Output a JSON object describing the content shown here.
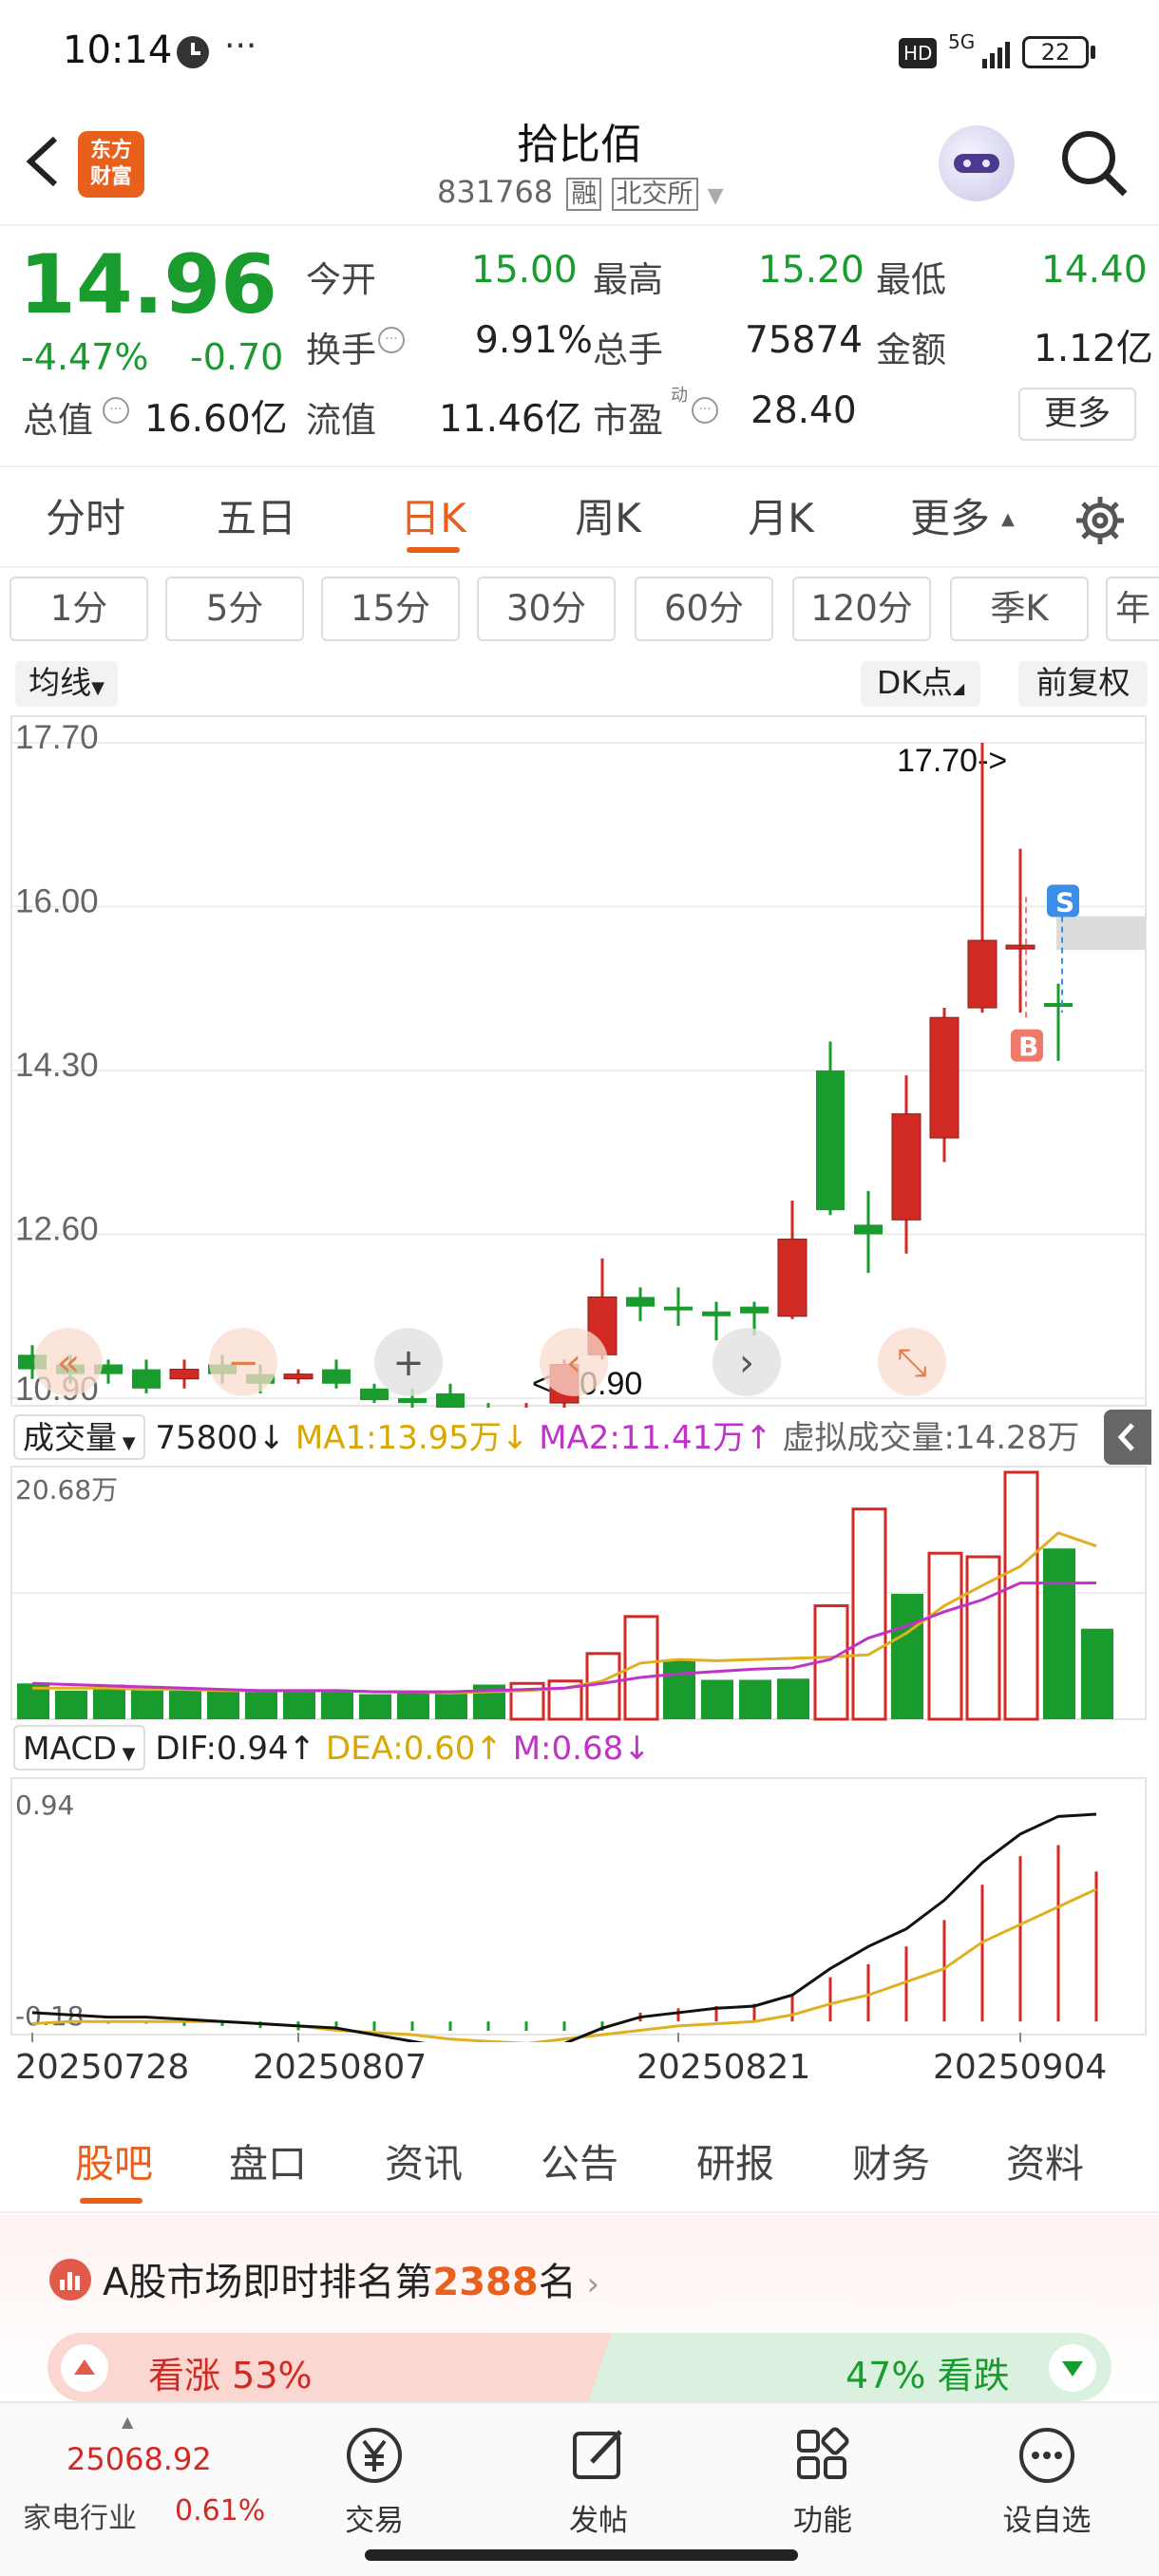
{
  "status_bar": {
    "time": "10:14",
    "dots": "···",
    "hd": "HD",
    "network": "5G",
    "battery": "22"
  },
  "header": {
    "logo_line1": "东方",
    "logo_line2": "财富",
    "stock_name": "拾比佰",
    "stock_code": "831768",
    "tag_margin": "融",
    "tag_exchange": "北交所"
  },
  "quote": {
    "price": "14.96",
    "change_pct": "-4.47%",
    "change_amt": "-0.70",
    "fields": {
      "open_label": "今开",
      "open": "15.00",
      "high_label": "最高",
      "high": "15.20",
      "low_label": "最低",
      "low": "14.40",
      "turnover_label": "换手",
      "turnover": "9.91%",
      "volume_label": "总手",
      "volume": "75874",
      "amount_label": "金额",
      "amount": "1.12亿",
      "total_value_label": "总值",
      "total_value": "16.60亿",
      "float_value_label": "流值",
      "float_value": "11.46亿",
      "pe_label": "市盈",
      "pe_sup": "动",
      "pe": "28.40"
    },
    "more_button": "更多"
  },
  "period_tabs": [
    "分时",
    "五日",
    "日K",
    "周K",
    "月K",
    "更多"
  ],
  "active_period": "日K",
  "minute_pills": [
    "1分",
    "5分",
    "15分",
    "30分",
    "60分",
    "120分",
    "季K",
    "年"
  ],
  "chart_controls": {
    "ma_label": "均线",
    "dk_label": "DK点",
    "adjust_label": "前复权"
  },
  "chart_data": [
    {
      "type": "candlestick",
      "title": "日K",
      "y_ticks": [
        "17.70",
        "16.00",
        "14.30",
        "12.60",
        "10.90"
      ],
      "ylim": [
        10.9,
        17.7
      ],
      "max_annotation": "17.70->",
      "min_annotation": "<-10.90",
      "candles": [
        {
          "o": 11.35,
          "c": 11.2,
          "h": 11.45,
          "l": 11.1
        },
        {
          "o": 11.25,
          "c": 11.15,
          "h": 11.35,
          "l": 11.05
        },
        {
          "o": 11.25,
          "c": 11.15,
          "h": 11.3,
          "l": 11.05
        },
        {
          "o": 11.2,
          "c": 11.0,
          "h": 11.3,
          "l": 10.95
        },
        {
          "o": 11.1,
          "c": 11.2,
          "h": 11.3,
          "l": 11.0
        },
        {
          "o": 11.25,
          "c": 11.15,
          "h": 11.35,
          "l": 11.05
        },
        {
          "o": 11.15,
          "c": 11.05,
          "h": 11.25,
          "l": 10.95
        },
        {
          "o": 11.1,
          "c": 11.15,
          "h": 11.2,
          "l": 11.05
        },
        {
          "o": 11.2,
          "c": 11.05,
          "h": 11.3,
          "l": 11.0
        },
        {
          "o": 11.0,
          "c": 10.88,
          "h": 11.05,
          "l": 10.85
        },
        {
          "o": 10.9,
          "c": 10.85,
          "h": 11.0,
          "l": 10.8
        },
        {
          "o": 10.95,
          "c": 10.75,
          "h": 11.05,
          "l": 10.7
        },
        {
          "o": 10.8,
          "c": 10.65,
          "h": 10.85,
          "l": 10.6
        },
        {
          "o": 10.45,
          "c": 10.75,
          "h": 10.85,
          "l": 10.3
        },
        {
          "o": 10.85,
          "c": 11.25,
          "h": 11.3,
          "l": 10.8
        },
        {
          "o": 11.35,
          "c": 11.95,
          "h": 12.35,
          "l": 11.3
        },
        {
          "o": 11.95,
          "c": 11.85,
          "h": 12.05,
          "l": 11.7
        },
        {
          "o": 11.85,
          "c": 11.83,
          "h": 12.05,
          "l": 11.65
        },
        {
          "o": 11.8,
          "c": 11.75,
          "h": 11.9,
          "l": 11.5
        },
        {
          "o": 11.85,
          "c": 11.78,
          "h": 11.9,
          "l": 11.55
        },
        {
          "o": 11.75,
          "c": 12.55,
          "h": 12.95,
          "l": 11.72
        },
        {
          "o": 14.3,
          "c": 12.85,
          "h": 14.6,
          "l": 12.8
        },
        {
          "o": 12.7,
          "c": 12.6,
          "h": 13.05,
          "l": 12.2
        },
        {
          "o": 12.75,
          "c": 13.85,
          "h": 14.25,
          "l": 12.4
        },
        {
          "o": 13.6,
          "c": 14.85,
          "h": 14.95,
          "l": 13.35
        },
        {
          "o": 14.95,
          "c": 15.65,
          "h": 17.7,
          "l": 14.9
        },
        {
          "o": 15.6,
          "c": 15.6,
          "h": 16.6,
          "l": 14.9
        },
        {
          "o": 15.0,
          "c": 14.96,
          "h": 15.2,
          "l": 14.4
        }
      ],
      "markers": [
        {
          "label": "S",
          "color": "#3a8ee6"
        },
        {
          "label": "B",
          "color": "#f07a6a"
        }
      ]
    },
    {
      "type": "bar",
      "title": "成交量",
      "header_value": "75800",
      "series": [
        {
          "name": "MA1",
          "label": "MA1:13.95万",
          "color": "#e0b020"
        },
        {
          "name": "MA2",
          "label": "MA2:11.41万",
          "color": "#c032c8"
        }
      ],
      "virtual_volume_label": "虚拟成交量:14.28万",
      "y_max_label": "20.68万",
      "values": [
        3.0,
        2.4,
        2.9,
        2.6,
        2.5,
        2.4,
        2.3,
        2.5,
        2.4,
        2.1,
        2.2,
        2.4,
        2.9,
        3.0,
        3.2,
        5.5,
        8.6,
        4.9,
        3.3,
        3.3,
        3.4,
        9.5,
        17.6,
        10.5,
        13.9,
        13.6,
        20.68,
        14.3,
        7.58
      ],
      "rising": [
        false,
        false,
        false,
        false,
        false,
        false,
        false,
        false,
        false,
        false,
        false,
        false,
        false,
        true,
        true,
        true,
        true,
        false,
        false,
        false,
        false,
        true,
        true,
        false,
        true,
        true,
        true,
        false,
        false
      ],
      "ma1": [
        2.6,
        2.6,
        2.6,
        2.5,
        2.5,
        2.4,
        2.4,
        2.4,
        2.4,
        2.3,
        2.3,
        2.2,
        2.3,
        2.4,
        2.6,
        3.2,
        4.7,
        5.0,
        4.9,
        5.0,
        5.1,
        5.2,
        5.4,
        7.2,
        9.5,
        11.2,
        12.8,
        15.6,
        14.5
      ],
      "ma2": [
        3.0,
        2.9,
        2.8,
        2.7,
        2.6,
        2.5,
        2.4,
        2.4,
        2.4,
        2.3,
        2.3,
        2.3,
        2.4,
        2.5,
        2.6,
        3.0,
        3.5,
        3.8,
        4.0,
        4.2,
        4.3,
        5.0,
        6.8,
        7.8,
        9.0,
        10.0,
        11.4,
        11.4,
        11.41
      ]
    },
    {
      "type": "bar",
      "title": "MACD",
      "dif_label": "DIF:0.94",
      "dea_label": "DEA:0.60",
      "m_label": "M:0.68",
      "ylim": [
        -0.18,
        0.94
      ],
      "y_top_label": "0.94",
      "y_bottom_label": "-0.18",
      "x_labels": [
        "20250728",
        "20250807",
        "20250821",
        "20250904"
      ],
      "dif": [
        0.04,
        0.03,
        0.02,
        0.02,
        0.01,
        0.0,
        -0.01,
        -0.02,
        -0.03,
        -0.06,
        -0.09,
        -0.12,
        -0.15,
        -0.15,
        -0.1,
        -0.03,
        0.02,
        0.04,
        0.06,
        0.07,
        0.12,
        0.24,
        0.34,
        0.42,
        0.55,
        0.72,
        0.85,
        0.93,
        0.94
      ],
      "dea": [
        -0.01,
        -0.0,
        0.0,
        0.0,
        0.0,
        0.0,
        -0.01,
        -0.02,
        -0.04,
        -0.05,
        -0.06,
        -0.08,
        -0.09,
        -0.1,
        -0.08,
        -0.06,
        -0.04,
        -0.02,
        -0.01,
        0.0,
        0.03,
        0.08,
        0.12,
        0.18,
        0.24,
        0.36,
        0.44,
        0.52,
        0.6
      ],
      "m": [
        0.0,
        -0.01,
        -0.01,
        -0.01,
        -0.02,
        -0.02,
        -0.03,
        -0.04,
        -0.06,
        -0.08,
        -0.1,
        -0.12,
        -0.14,
        -0.16,
        -0.12,
        -0.06,
        0.04,
        0.06,
        0.07,
        0.08,
        0.12,
        0.2,
        0.26,
        0.34,
        0.46,
        0.62,
        0.75,
        0.8,
        0.68
      ]
    }
  ],
  "news_tabs": [
    "股吧",
    "盘口",
    "资讯",
    "公告",
    "研报",
    "财务",
    "资料"
  ],
  "active_news_tab": "股吧",
  "ranking": {
    "prefix": "A股市场即时排名第",
    "rank": "2388",
    "suffix": "名"
  },
  "sentiment": {
    "up_label": "看涨",
    "up_pct": "53%",
    "down_pct": "47%",
    "down_label": "看跌"
  },
  "footer": {
    "index_value": "25068.92",
    "sector_label": "家电行业",
    "sector_change": "0.61%",
    "trade_label": "交易",
    "post_label": "发帖",
    "function_label": "功能",
    "watchlist_label": "设自选"
  },
  "colors": {
    "up": "#d12a24",
    "down": "#1a9b2e",
    "accent": "#e8601c"
  }
}
